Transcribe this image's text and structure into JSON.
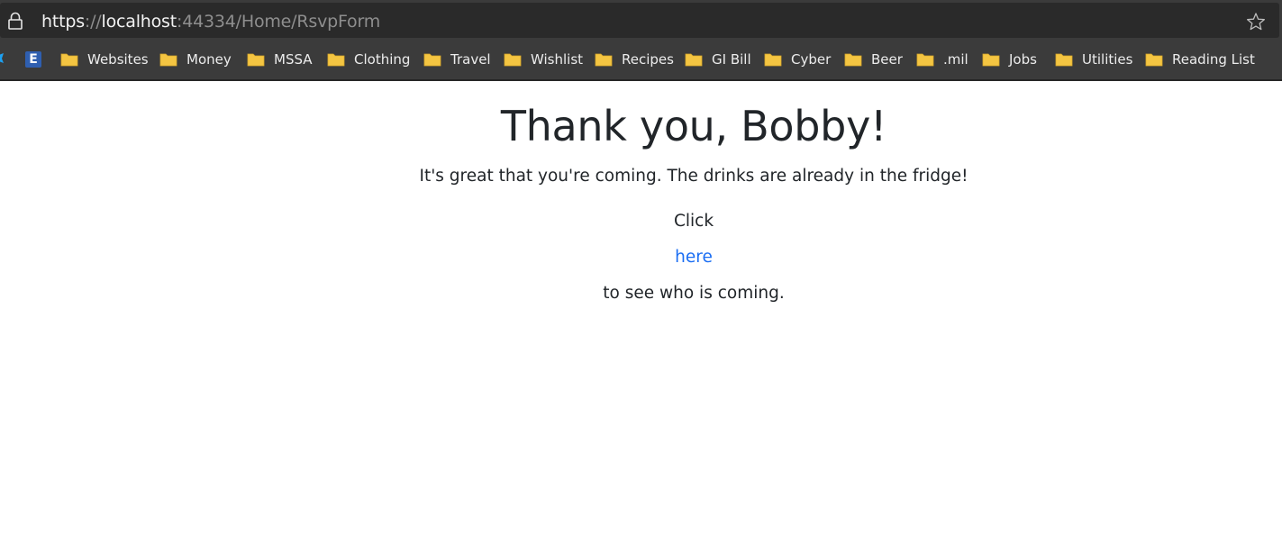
{
  "browser": {
    "url": {
      "scheme": "https",
      "separator": "://",
      "host": "localhost",
      "rest": ":44334/Home/RsvpForm"
    },
    "favorite_icon": "star-outline-icon",
    "lock_icon": "lock-icon"
  },
  "bookmarks": {
    "ebay_icon_letter": "E",
    "items": [
      {
        "label": "Websites"
      },
      {
        "label": "Money"
      },
      {
        "label": "MSSA"
      },
      {
        "label": "Clothing"
      },
      {
        "label": "Travel"
      },
      {
        "label": "Wishlist"
      },
      {
        "label": "Recipes"
      },
      {
        "label": "GI Bill"
      },
      {
        "label": "Cyber"
      },
      {
        "label": "Beer"
      },
      {
        "label": ".mil"
      },
      {
        "label": "Jobs"
      },
      {
        "label": "Utilities"
      },
      {
        "label": "Reading List"
      }
    ],
    "folder_color": "#f4c542"
  },
  "page": {
    "heading": "Thank you, Bobby!",
    "message": "It's great that you're coming. The drinks are already in the fridge!",
    "click_text": "Click",
    "link_text": "here",
    "after_link_text": "to see who is coming.",
    "link_color": "#1b6ef3"
  }
}
